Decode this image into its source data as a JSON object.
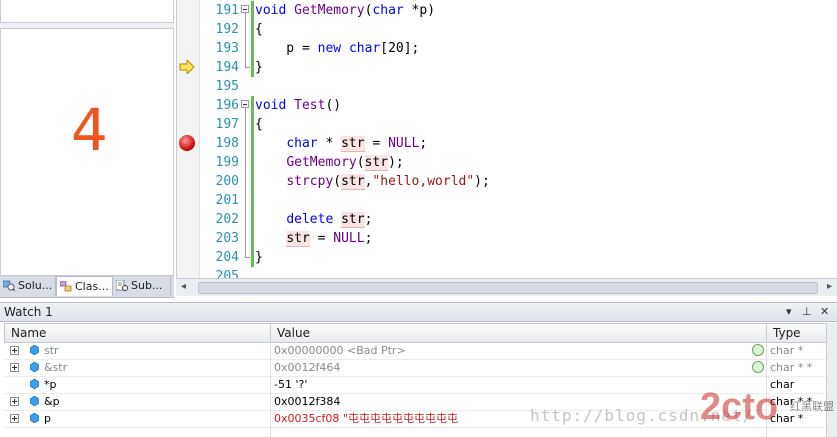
{
  "left_pane": {
    "number": "4",
    "tabs": [
      {
        "label": "Solu...",
        "icon": "solution-explorer-icon"
      },
      {
        "label": "Clas...",
        "icon": "class-view-icon"
      },
      {
        "label": "Sub...",
        "icon": "subversion-icon"
      }
    ]
  },
  "editor": {
    "lines": [
      {
        "n": "191",
        "code": "void GetMemory(char *p)"
      },
      {
        "n": "192",
        "code": "{"
      },
      {
        "n": "193",
        "code": "    p = new char[20];"
      },
      {
        "n": "194",
        "code": "}"
      },
      {
        "n": "195",
        "code": ""
      },
      {
        "n": "196",
        "code": "void Test()"
      },
      {
        "n": "197",
        "code": "{"
      },
      {
        "n": "198",
        "code": "    char * str = NULL;"
      },
      {
        "n": "199",
        "code": "    GetMemory(str);"
      },
      {
        "n": "200",
        "code": "    strcpy(str,\"hello,world\");"
      },
      {
        "n": "201",
        "code": ""
      },
      {
        "n": "202",
        "code": "    delete str;"
      },
      {
        "n": "203",
        "code": "    str = NULL;"
      },
      {
        "n": "204",
        "code": "}"
      },
      {
        "n": "205",
        "code": ""
      }
    ],
    "current_line": "194",
    "breakpoint_line": "198"
  },
  "watch": {
    "title": "Watch 1",
    "controls": {
      "dropdown": "▾",
      "pin": "⊥",
      "close": "✕"
    },
    "columns": {
      "name": "Name",
      "value": "Value",
      "type": "Type"
    },
    "rows": [
      {
        "name": "str",
        "value": "0x00000000 <Bad Ptr>",
        "type": "char *",
        "expandable": true,
        "style": "gray",
        "refresh": true
      },
      {
        "name": "&str",
        "value": "0x0012f464",
        "type": "char * *",
        "expandable": true,
        "style": "gray",
        "refresh": true
      },
      {
        "name": "*p",
        "value": "-51 '?'",
        "type": "char",
        "expandable": false,
        "style": "black",
        "refresh": false
      },
      {
        "name": "&p",
        "value": "0x0012f384",
        "type": "char * *",
        "expandable": true,
        "style": "black",
        "refresh": false
      },
      {
        "name": "p",
        "value": "0x0035cf08 \"屯屯屯屯屯屯屯屯屯屯",
        "type": "char *",
        "expandable": true,
        "style": "red",
        "refresh": false
      }
    ]
  },
  "watermark": {
    "url": "http://blog.csdn.net/",
    "logo": "2cto",
    "logo_sub": "红黑联盟"
  },
  "colors": {
    "accent_number": "#f0551f",
    "keyword": "#0000ff",
    "line_number": "#2b91af",
    "string": "#a31515",
    "changed_value": "#d21a1a"
  }
}
